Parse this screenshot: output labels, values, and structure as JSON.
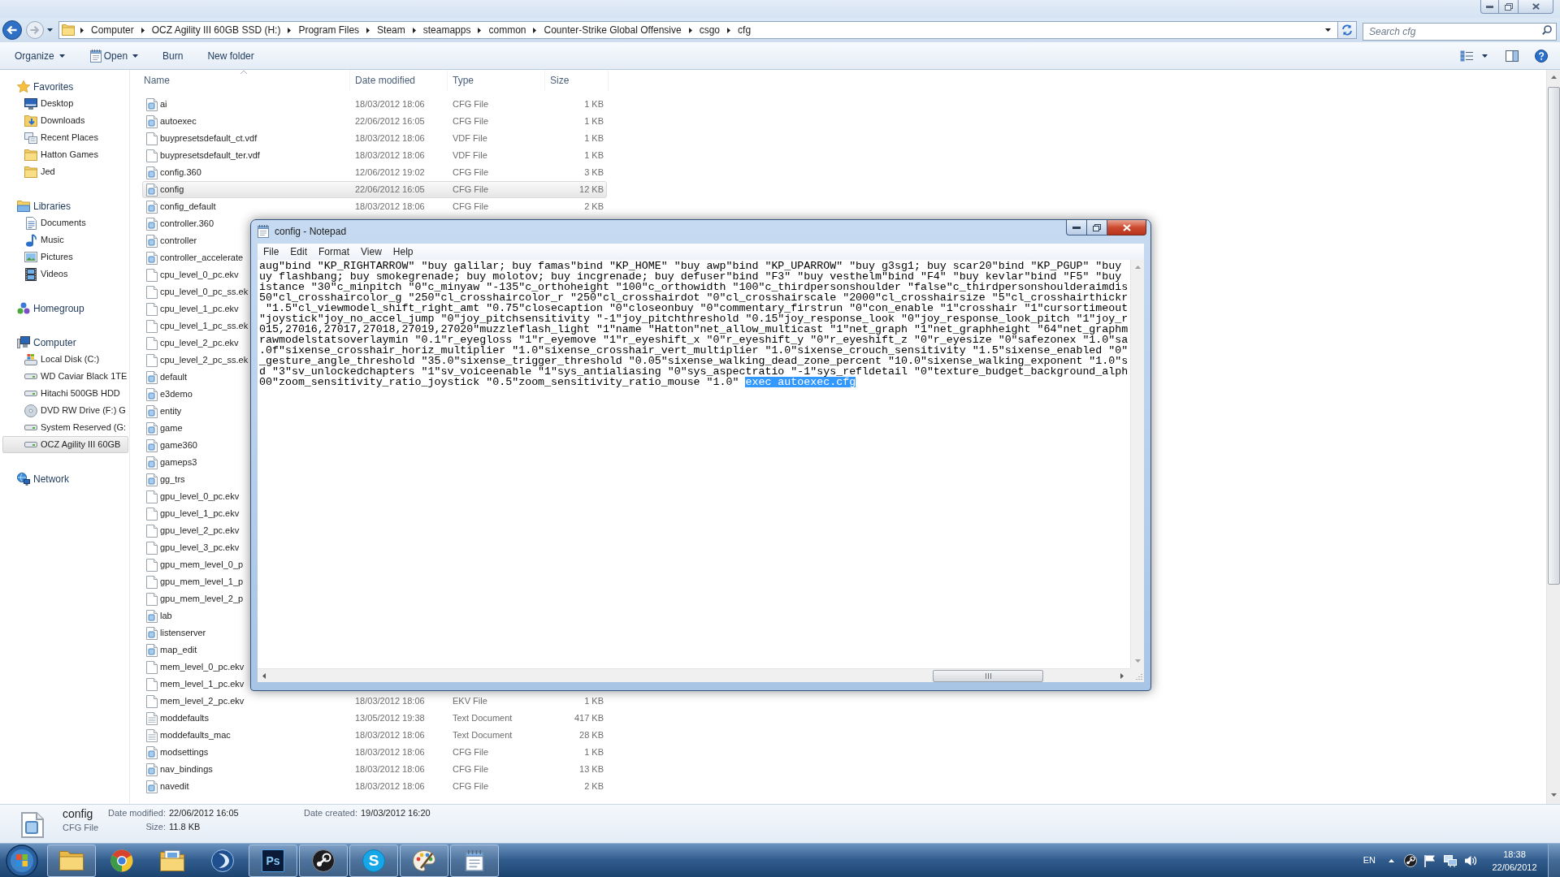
{
  "explorer": {
    "address_bar": {
      "path": [
        "Computer",
        "OCZ Agility III 60GB SSD (H:)",
        "Program Files",
        "Steam",
        "steamapps",
        "common",
        "Counter-Strike Global Offensive",
        "csgo",
        "cfg"
      ]
    },
    "search": {
      "placeholder": "Search cfg"
    },
    "toolbar": [
      {
        "label": "Organize",
        "kind": "dropdown"
      },
      {
        "label": "Open",
        "kind": "dropdown-with-icon"
      },
      {
        "label": "Burn",
        "kind": "button"
      },
      {
        "label": "New folder",
        "kind": "button"
      }
    ],
    "sidebar": [
      {
        "label": "Favorites",
        "kind": "favorites",
        "selected": false,
        "items": [
          {
            "label": "Desktop",
            "kind": "desktop",
            "selected": false
          },
          {
            "label": "Downloads",
            "kind": "downloads",
            "selected": false
          },
          {
            "label": "Recent Places",
            "kind": "recent",
            "selected": false
          },
          {
            "label": "Hatton Games",
            "kind": "folder",
            "selected": false
          },
          {
            "label": "Jed",
            "kind": "folder",
            "selected": false
          }
        ]
      },
      {
        "label": "Libraries",
        "kind": "libraries",
        "selected": false,
        "items": [
          {
            "label": "Documents",
            "kind": "documents",
            "selected": false
          },
          {
            "label": "Music",
            "kind": "music",
            "selected": false
          },
          {
            "label": "Pictures",
            "kind": "pictures",
            "selected": false
          },
          {
            "label": "Videos",
            "kind": "videos",
            "selected": false
          }
        ]
      },
      {
        "label": "Homegroup",
        "kind": "homegroup",
        "selected": false
      },
      {
        "label": "Computer",
        "kind": "computer",
        "selected": false,
        "items": [
          {
            "label": "Local Disk (C:)",
            "kind": "system-drive",
            "selected": false
          },
          {
            "label": "WD Caviar Black 1TE",
            "kind": "drive",
            "selected": false
          },
          {
            "label": "Hitachi 500GB HDD",
            "kind": "drive",
            "selected": false
          },
          {
            "label": "DVD RW Drive (F:) G",
            "kind": "disc",
            "selected": false
          },
          {
            "label": "System Reserved (G:",
            "kind": "drive",
            "selected": false
          },
          {
            "label": "OCZ Agility III 60GB",
            "kind": "drive",
            "selected": true
          }
        ]
      },
      {
        "label": "Network",
        "kind": "network",
        "selected": false
      }
    ],
    "file_list": {
      "columns": [
        "Name",
        "Date modified",
        "Type",
        "Size"
      ],
      "rows": [
        {
          "name": "ai",
          "date_modified": "18/03/2012 18:06",
          "type": "CFG File",
          "size": "1 KB",
          "kind": "cfg",
          "selected": false
        },
        {
          "name": "autoexec",
          "date_modified": "22/06/2012 16:05",
          "type": "CFG File",
          "size": "1 KB",
          "kind": "cfg",
          "selected": false
        },
        {
          "name": "buypresetsdefault_ct.vdf",
          "date_modified": "18/03/2012 18:06",
          "type": "VDF File",
          "size": "1 KB",
          "kind": "blank",
          "selected": false
        },
        {
          "name": "buypresetsdefault_ter.vdf",
          "date_modified": "18/03/2012 18:06",
          "type": "VDF File",
          "size": "1 KB",
          "kind": "blank",
          "selected": false
        },
        {
          "name": "config.360",
          "date_modified": "12/06/2012 19:02",
          "type": "CFG File",
          "size": "3 KB",
          "kind": "cfg",
          "selected": false
        },
        {
          "name": "config",
          "date_modified": "22/06/2012 16:05",
          "type": "CFG File",
          "size": "12 KB",
          "kind": "cfg",
          "selected": true
        },
        {
          "name": "config_default",
          "date_modified": "18/03/2012 18:06",
          "type": "CFG File",
          "size": "2 KB",
          "kind": "cfg",
          "selected": false
        },
        {
          "name": "controller.360",
          "kind": "cfg",
          "selected": false
        },
        {
          "name": "controller",
          "kind": "cfg",
          "selected": false
        },
        {
          "name": "controller_accelerate",
          "kind": "cfg",
          "selected": false
        },
        {
          "name": "cpu_level_0_pc.ekv",
          "kind": "blank",
          "selected": false
        },
        {
          "name": "cpu_level_0_pc_ss.ek",
          "kind": "blank",
          "selected": false
        },
        {
          "name": "cpu_level_1_pc.ekv",
          "kind": "blank",
          "selected": false
        },
        {
          "name": "cpu_level_1_pc_ss.ek",
          "kind": "blank",
          "selected": false
        },
        {
          "name": "cpu_level_2_pc.ekv",
          "kind": "blank",
          "selected": false
        },
        {
          "name": "cpu_level_2_pc_ss.ek",
          "kind": "blank",
          "selected": false
        },
        {
          "name": "default",
          "kind": "cfg",
          "selected": false
        },
        {
          "name": "e3demo",
          "kind": "cfg",
          "selected": false
        },
        {
          "name": "entity",
          "kind": "cfg",
          "selected": false
        },
        {
          "name": "game",
          "kind": "cfg",
          "selected": false
        },
        {
          "name": "game360",
          "kind": "cfg",
          "selected": false
        },
        {
          "name": "gameps3",
          "kind": "cfg",
          "selected": false
        },
        {
          "name": "gg_trs",
          "kind": "cfg",
          "selected": false
        },
        {
          "name": "gpu_level_0_pc.ekv",
          "kind": "blank",
          "selected": false
        },
        {
          "name": "gpu_level_1_pc.ekv",
          "kind": "blank",
          "selected": false
        },
        {
          "name": "gpu_level_2_pc.ekv",
          "kind": "blank",
          "selected": false
        },
        {
          "name": "gpu_level_3_pc.ekv",
          "kind": "blank",
          "selected": false
        },
        {
          "name": "gpu_mem_level_0_p",
          "kind": "blank",
          "selected": false
        },
        {
          "name": "gpu_mem_level_1_p",
          "kind": "blank",
          "selected": false
        },
        {
          "name": "gpu_mem_level_2_p",
          "kind": "blank",
          "selected": false
        },
        {
          "name": "lab",
          "kind": "cfg",
          "selected": false
        },
        {
          "name": "listenserver",
          "kind": "cfg",
          "selected": false
        },
        {
          "name": "map_edit",
          "kind": "cfg",
          "selected": false
        },
        {
          "name": "mem_level_0_pc.ekv",
          "kind": "blank",
          "selected": false
        },
        {
          "name": "mem_level_1_pc.ekv",
          "kind": "blank",
          "selected": false
        },
        {
          "name": "mem_level_2_pc.ekv",
          "date_modified": "18/03/2012 18:06",
          "type": "EKV File",
          "size": "1 KB",
          "kind": "blank",
          "selected": false
        },
        {
          "name": "moddefaults",
          "date_modified": "13/05/2012 19:38",
          "type": "Text Document",
          "size": "417 KB",
          "kind": "text",
          "selected": false
        },
        {
          "name": "moddefaults_mac",
          "date_modified": "18/03/2012 18:06",
          "type": "Text Document",
          "size": "28 KB",
          "kind": "text",
          "selected": false
        },
        {
          "name": "modsettings",
          "date_modified": "18/03/2012 18:06",
          "type": "CFG File",
          "size": "1 KB",
          "kind": "cfg",
          "selected": false
        },
        {
          "name": "nav_bindings",
          "date_modified": "18/03/2012 18:06",
          "type": "CFG File",
          "size": "13 KB",
          "kind": "cfg",
          "selected": false
        },
        {
          "name": "navedit",
          "date_modified": "18/03/2012 18:06",
          "type": "CFG File",
          "size": "2 KB",
          "kind": "cfg",
          "selected": false
        }
      ]
    },
    "details_pane": {
      "name": "config",
      "type": "CFG File",
      "fields": [
        {
          "label": "Date modified:",
          "value": "22/06/2012 16:05"
        },
        {
          "label": "Size:",
          "value": "11.8 KB"
        },
        {
          "label": "Date created:",
          "value": "19/03/2012 16:20"
        }
      ]
    }
  },
  "notepad": {
    "title": "config - Notepad",
    "menu": [
      "File",
      "Edit",
      "Format",
      "View",
      "Help"
    ],
    "lines": [
      "aug\"bind \"KP_RIGHTARROW\" \"buy galilar; buy famas\"bind \"KP_HOME\" \"buy awp\"bind \"KP_UPARROW\" \"buy g3sg1; buy scar20\"bind \"KP_PGUP\" \"buy",
      "uy flashbang; buy smokegrenade; buy molotov; buy incgrenade; buy defuser\"bind \"F3\" \"buy vesthelm\"bind \"F4\" \"buy kevlar\"bind \"F5\" \"buy",
      "istance \"30\"c_minpitch \"0\"c_minyaw \"-135\"c_orthoheight \"100\"c_orthowidth \"100\"c_thirdpersonshoulder \"false\"c_thirdpersonshoulderaimdis",
      "50\"cl_crosshaircolor_g \"250\"cl_crosshaircolor_r \"250\"cl_crosshairdot \"0\"cl_crosshairscale \"2000\"cl_crosshairsize \"5\"cl_crosshairthickr",
      " \"1.5\"cl_viewmodel_shift_right_amt \"0.75\"closecaption \"0\"closeonbuy \"0\"commentary_firstrun \"0\"con_enable \"1\"crosshair \"1\"cursortimeout",
      "\"joystick\"joy_no_accel_jump \"0\"joy_pitchsensitivity \"-1\"joy_pitchthreshold \"0.15\"joy_response_look \"0\"joy_response_look_pitch \"1\"joy_r",
      "015,27016,27017,27018,27019,27020\"muzzleflash_light \"1\"name \"Hatton\"net_allow_multicast \"1\"net_graph \"1\"net_graphheight \"64\"net_graphm",
      "rawmodelstatsoverlaymin \"0.1\"r_eyegloss \"1\"r_eyemove \"1\"r_eyeshift_x \"0\"r_eyeshift_y \"0\"r_eyeshift_z \"0\"r_eyesize \"0\"safezonex \"1.0\"sa",
      ".0f\"sixense_crosshair_horiz_multiplier \"1.0\"sixense_crosshair_vert_multiplier \"1.0\"sixense_crouch_sensitivity \"1.5\"sixense_enabled \"0\"",
      "_gesture_angle_threshold \"35.0\"sixense_trigger_threshold \"0.05\"sixense_walking_dead_zone_percent \"10.0\"sixense_walking_exponent \"1.0\"s",
      "d \"3\"sv_unlockedchapters \"1\"sv_voiceenable \"1\"sys_antialiasing \"0\"sys_aspectratio \"-1\"sys_refldetail \"0\"texture_budget_background_alph",
      "00\"zoom_sensitivity_ratio_joystick \"0.5\"zoom_sensitivity_ratio_mouse \"1.0\" "
    ],
    "selection": "exec autoexec.cfg"
  },
  "taskbar": {
    "apps": [
      {
        "kind": "folder",
        "running": true
      },
      {
        "kind": "browser",
        "running": false
      },
      {
        "kind": "folder-stack",
        "running": false
      },
      {
        "kind": "swirl",
        "running": false
      },
      {
        "kind": "letter-tile",
        "label": "Ps",
        "running": true
      },
      {
        "kind": "wheel",
        "running": true
      },
      {
        "kind": "letter-bubble",
        "label": "S",
        "running": true
      },
      {
        "kind": "palette",
        "running": true
      },
      {
        "kind": "notepad",
        "running": true
      }
    ],
    "language": "EN",
    "clock": {
      "time": "18:38",
      "date": "22/06/2012"
    }
  }
}
